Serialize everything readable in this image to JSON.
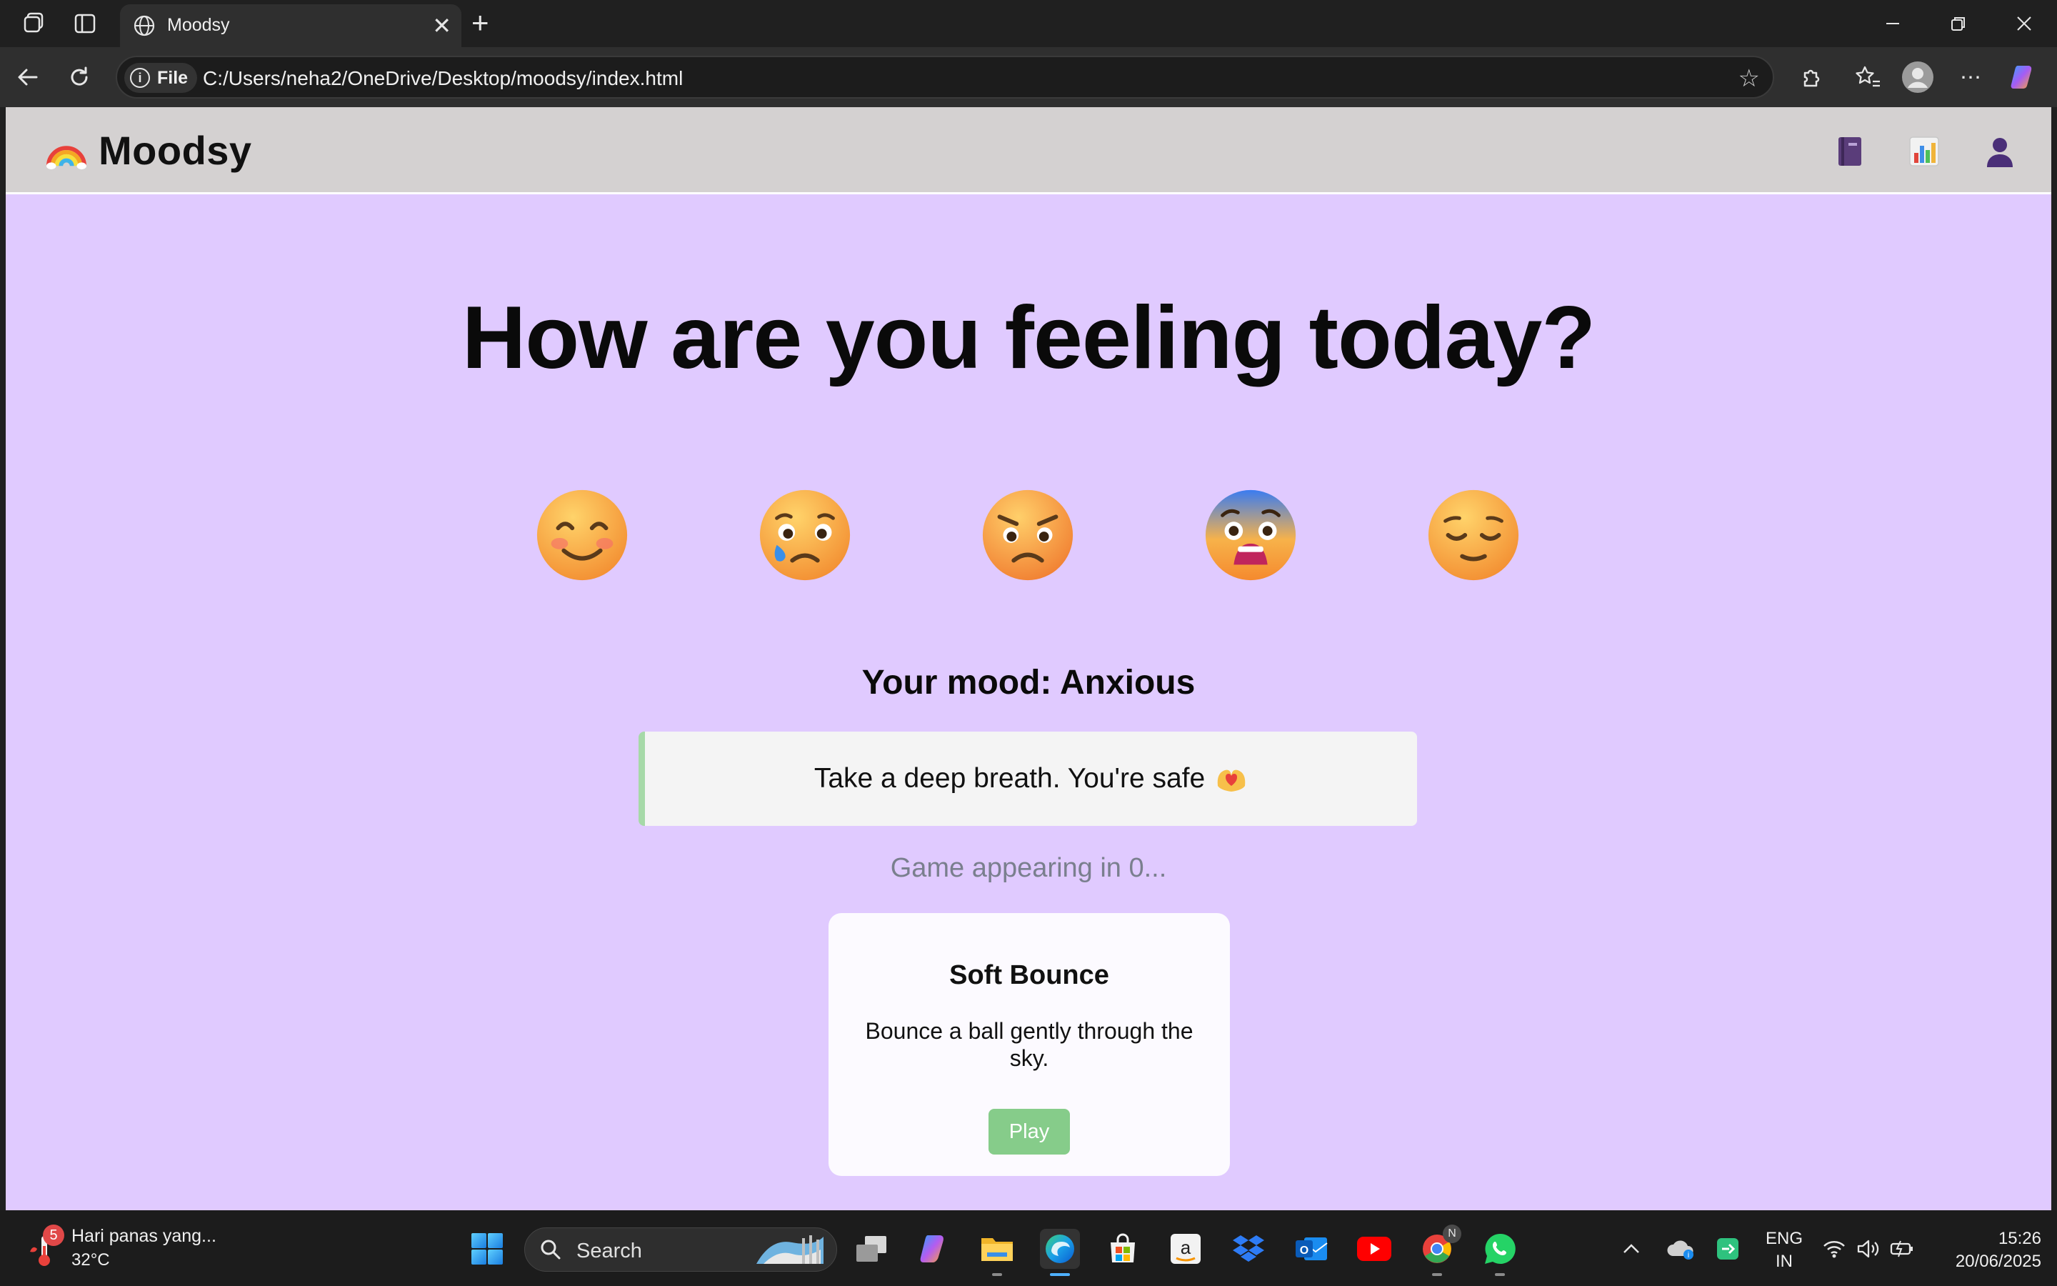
{
  "browser": {
    "tab_title": "Moodsy",
    "address": "C:/Users/neha2/OneDrive/Desktop/moodsy/index.html",
    "scheme_label": "File"
  },
  "site": {
    "brand": "Moodsy",
    "headline": "How are you feeling today?",
    "moods": [
      {
        "name": "happy",
        "glyph": "😊"
      },
      {
        "name": "sad",
        "glyph": "😢"
      },
      {
        "name": "angry",
        "glyph": "😠"
      },
      {
        "name": "anxious",
        "glyph": "😨"
      },
      {
        "name": "calm",
        "glyph": "😌"
      }
    ],
    "mood_line": "Your mood: Anxious",
    "message": "Take a deep breath. You're safe",
    "countdown": "Game appearing in 0...",
    "game": {
      "title": "Soft Bounce",
      "description": "Bounce a ball gently through the sky.",
      "play_label": "Play"
    }
  },
  "taskbar": {
    "weather_text": "Hari panas yang...",
    "weather_temp": "32°C",
    "weather_badge": "5",
    "search_placeholder": "Search",
    "lang_line1": "ENG",
    "lang_line2": "IN",
    "time": "15:26",
    "date": "20/06/2025",
    "chrome_badge": "N"
  },
  "colors": {
    "page_bg": "#e0caff",
    "header_bg": "#d4d1d1",
    "message_accent": "#a6d9a8",
    "play_button": "#86cc8a"
  }
}
